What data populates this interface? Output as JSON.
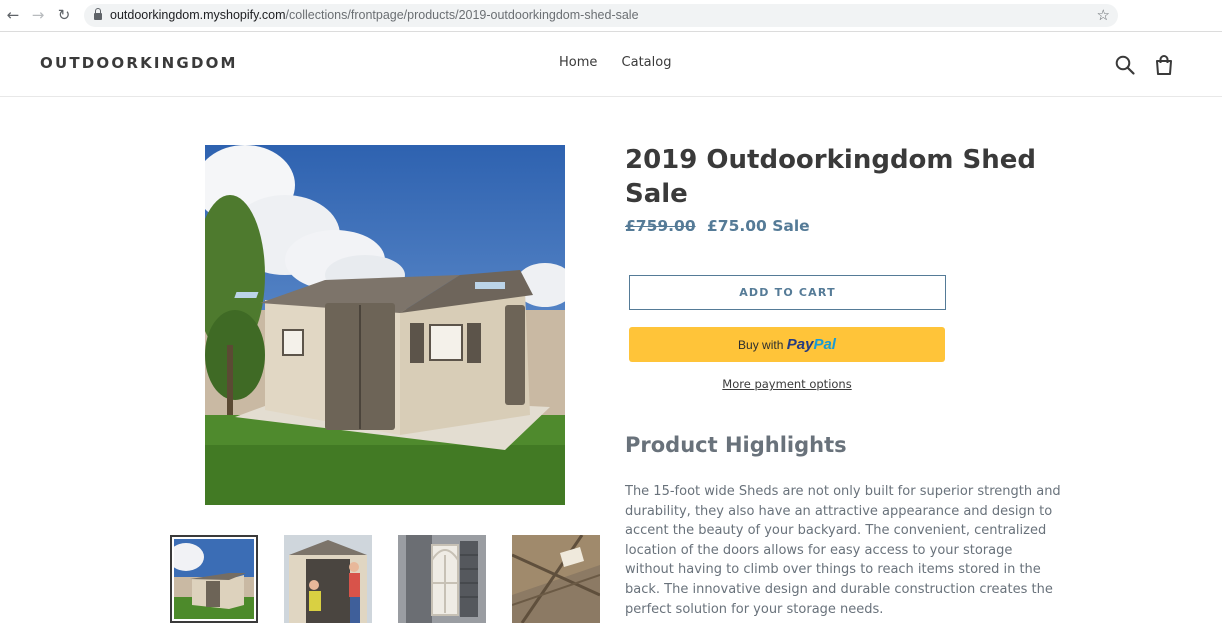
{
  "browser": {
    "url_host": "outdoorkingdom.myshopify.com",
    "url_path": "/collections/frontpage/products/2019-outdoorkingdom-shed-sale",
    "icons": [
      "back-arrow-icon",
      "forward-arrow-icon",
      "reload-icon",
      "lock-icon",
      "star-icon"
    ]
  },
  "header": {
    "logo": "OUTDOORKINGDOM",
    "nav": [
      "Home",
      "Catalog"
    ],
    "icons": [
      "search-icon",
      "cart-icon"
    ]
  },
  "product": {
    "title": "2019 Outdoorkingdom Shed Sale",
    "old_price": "£759.00",
    "price": "£75.00",
    "sale_label": "Sale",
    "add_to_cart": "ADD TO CART",
    "paypal_prefix": "Buy with",
    "paypal_brand_1": "Pay",
    "paypal_brand_2": "Pal",
    "more_payment": "More payment options",
    "highlights_heading": "Product Highlights",
    "description": "The 15-foot wide Sheds are not only built for superior strength and durability, they also have an attractive appearance and design to accent the beauty of your backyard. The convenient, centralized location of the doors allows for easy access to your storage without having to climb over things to reach items stored in the back. The innovative design and durable construction creates the perfect solution for your storage needs."
  },
  "colors": {
    "accent": "#557b97",
    "paypal_yellow": "#ffc439",
    "text": "#3a3a3a",
    "muted": "#69727b"
  }
}
